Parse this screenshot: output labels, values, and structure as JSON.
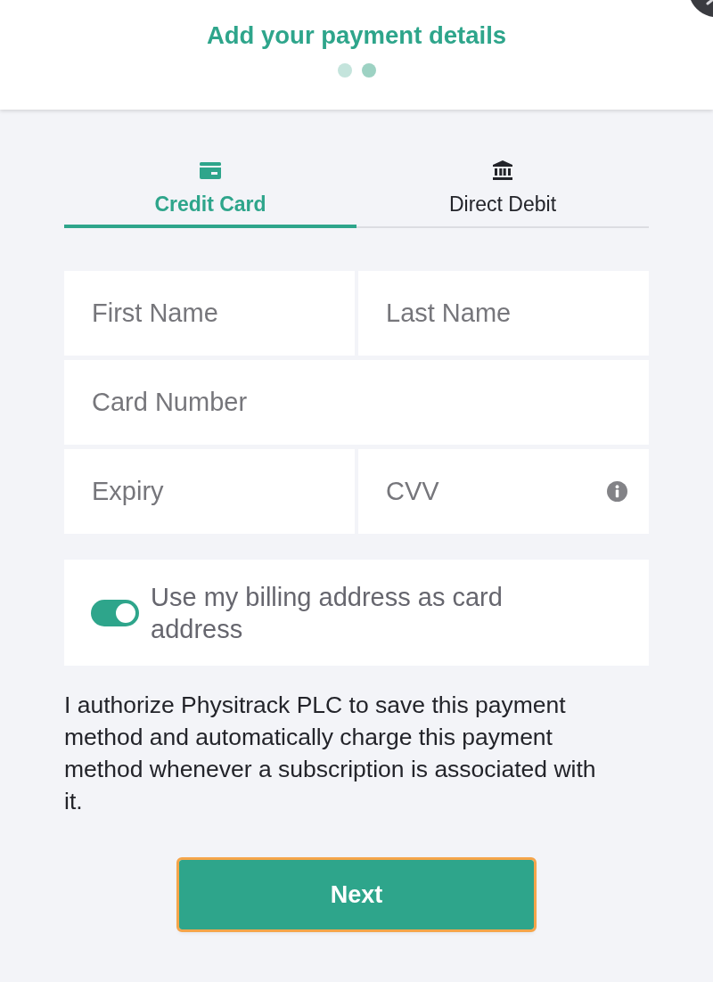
{
  "header": {
    "title": "Add your payment details",
    "steps": [
      {
        "selected": false
      },
      {
        "selected": true
      }
    ]
  },
  "tabs": [
    {
      "label": "Credit Card",
      "kind": "card",
      "selected": true
    },
    {
      "label": "Direct Debit",
      "kind": "bank",
      "selected": false
    }
  ],
  "form_rows": [
    {
      "fields": [
        {
          "placeholder": "First Name"
        },
        {
          "placeholder": "Last Name"
        }
      ]
    },
    {
      "fields": [
        {
          "placeholder": "Card Number"
        }
      ]
    },
    {
      "fields": [
        {
          "placeholder": "Expiry"
        },
        {
          "placeholder": "CVV",
          "info": true
        }
      ]
    }
  ],
  "billing_toggle": {
    "label": "Use my billing address as card address",
    "on": true
  },
  "authorization": "I authorize Physitrack PLC to save this payment method and automatically charge this payment method whenever a subscription is associated with it.",
  "next_button": {
    "label": "Next",
    "focused": true
  }
}
